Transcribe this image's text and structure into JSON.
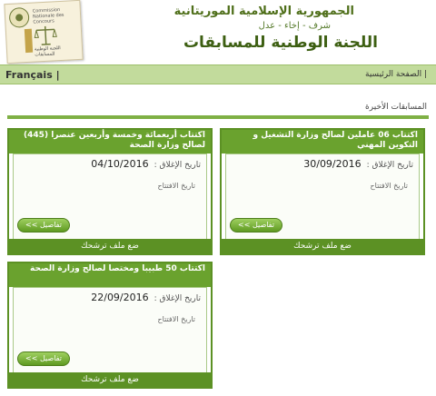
{
  "header": {
    "title_line1": "الجمهورية الإسلامية الموريتانية",
    "motto": "شرف - إخاء - عدل",
    "title_line2": "اللجنة الوطنية للمسابقات",
    "logo": {
      "top_text": "Commission Nationale des Concours",
      "bottom_text": "اللجنة الوطنية للمسابقات"
    }
  },
  "nav": {
    "language": "Français |",
    "home": "| الصفحة الرئيسية"
  },
  "section": {
    "title": "المسابقات الأخيرة"
  },
  "labels": {
    "closing_date": "تاريخ الإغلاق :",
    "opening_date": "تاريخ الافتتاح",
    "details": "تفاصيل >>",
    "apply": "ضع ملف ترشحك"
  },
  "cards": [
    {
      "title_number": "06",
      "title_text": "اكتتاب 06 عاملين لصالح وزارة التشغيل و التكوين المهني",
      "closing_date": "30/09/2016"
    },
    {
      "title_number": "(445)",
      "title_text": "اكتتاب أربعمائة وخمسة وأربعين عنصرا (445) لصالح وزارة الصحة",
      "closing_date": "04/10/2016"
    },
    {
      "title_number": "50",
      "title_text": "اكتتاب 50 طبيبا ومختصا لصالح وزارة الصحة",
      "closing_date": "22/09/2016"
    }
  ],
  "colors": {
    "nav_bg": "#c2db9c",
    "card_head": "#6aa22e",
    "card_border": "#5c9124",
    "title_green": "#3d5f12"
  }
}
